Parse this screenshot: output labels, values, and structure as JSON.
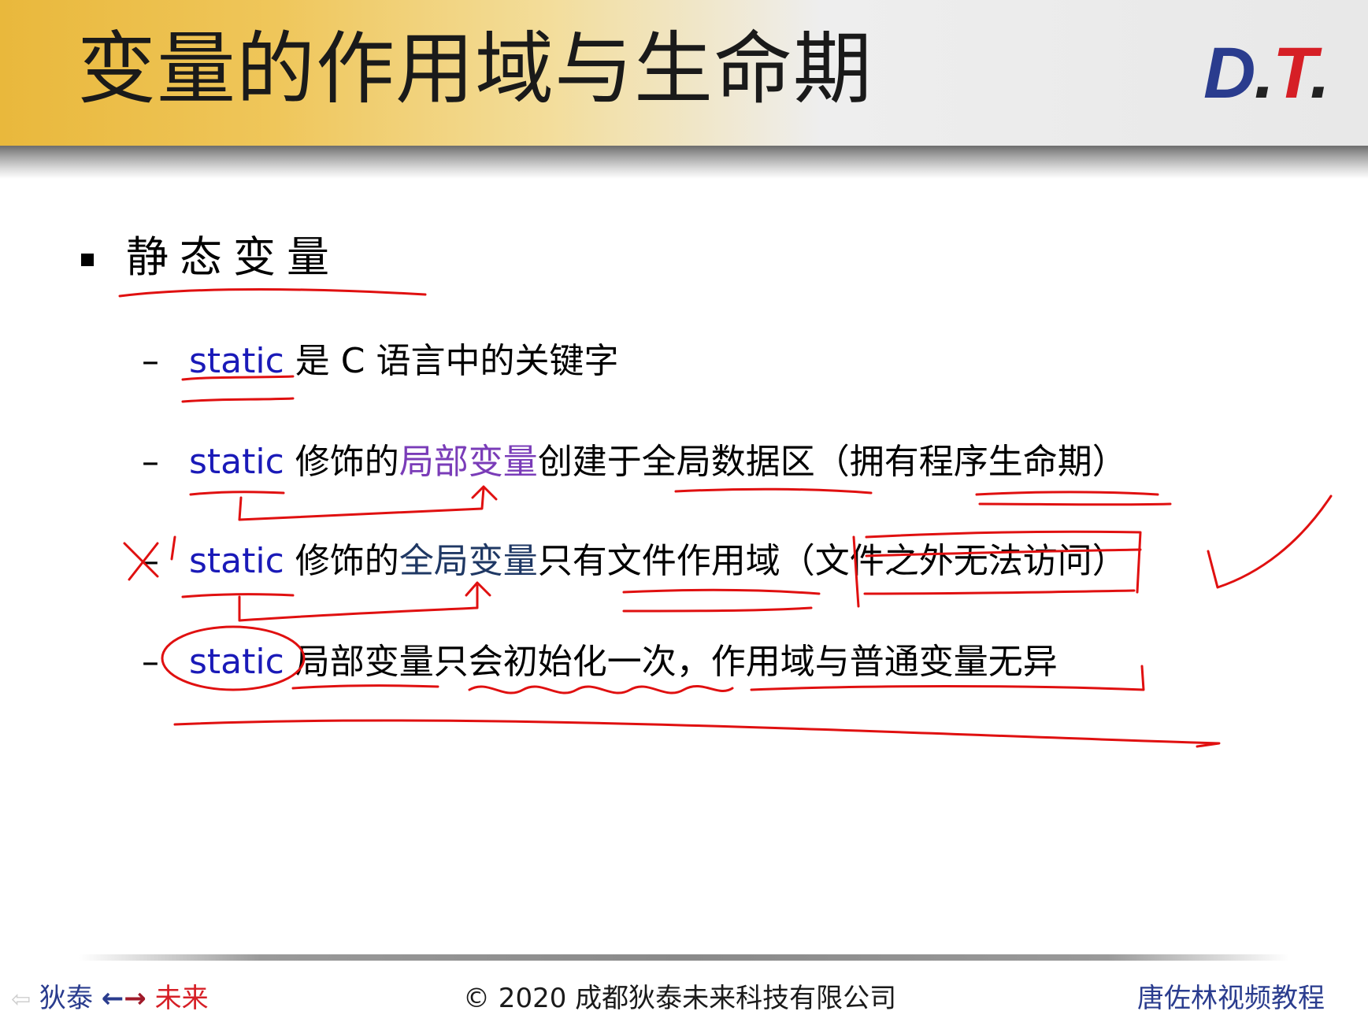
{
  "header": {
    "title": "变量的作用域与生命期",
    "logo": {
      "d": "D",
      "dot1": ".",
      "t": "T",
      "dot2": "."
    }
  },
  "content": {
    "heading": "静态变量",
    "rows": [
      {
        "dash": "–",
        "segments": [
          {
            "text": "static",
            "style": "keyword"
          },
          {
            "text": " 是 C 语言中的关键字",
            "style": "plain"
          }
        ]
      },
      {
        "dash": "–",
        "segments": [
          {
            "text": "static",
            "style": "keyword"
          },
          {
            "text": " 修饰的",
            "style": "plain"
          },
          {
            "text": "局部变量",
            "style": "highlight-purple"
          },
          {
            "text": "创建于全局数据区（拥有程序生命期）",
            "style": "plain"
          }
        ]
      },
      {
        "dash": "–",
        "segments": [
          {
            "text": "static",
            "style": "keyword"
          },
          {
            "text": " 修饰的",
            "style": "plain"
          },
          {
            "text": "全局变量",
            "style": "highlight-navy"
          },
          {
            "text": "只有文件作用域（文件之外无法访问）",
            "style": "plain"
          }
        ]
      },
      {
        "dash": "–",
        "segments": [
          {
            "text": "static",
            "style": "keyword"
          },
          {
            "text": " 局部变量只会初始化一次，作用域与普通变量无异",
            "style": "plain"
          }
        ]
      }
    ]
  },
  "footer": {
    "left": {
      "faint_arrow": "⇦",
      "word1": "狄泰",
      "arrow_left": "←",
      "arrow_right": "→",
      "word2": "未来"
    },
    "copyright": "© 2020 成都狄泰未来科技有限公司",
    "right": "唐佐林视频教程"
  },
  "colors": {
    "header_gold": "#e9b83c",
    "keyword_blue": "#1a1ab8",
    "highlight_purple": "#7a3cb8",
    "highlight_navy": "#1f3864",
    "ink_red": "#e01010",
    "logo_blue": "#2a3c8e",
    "logo_red": "#d61f26"
  }
}
